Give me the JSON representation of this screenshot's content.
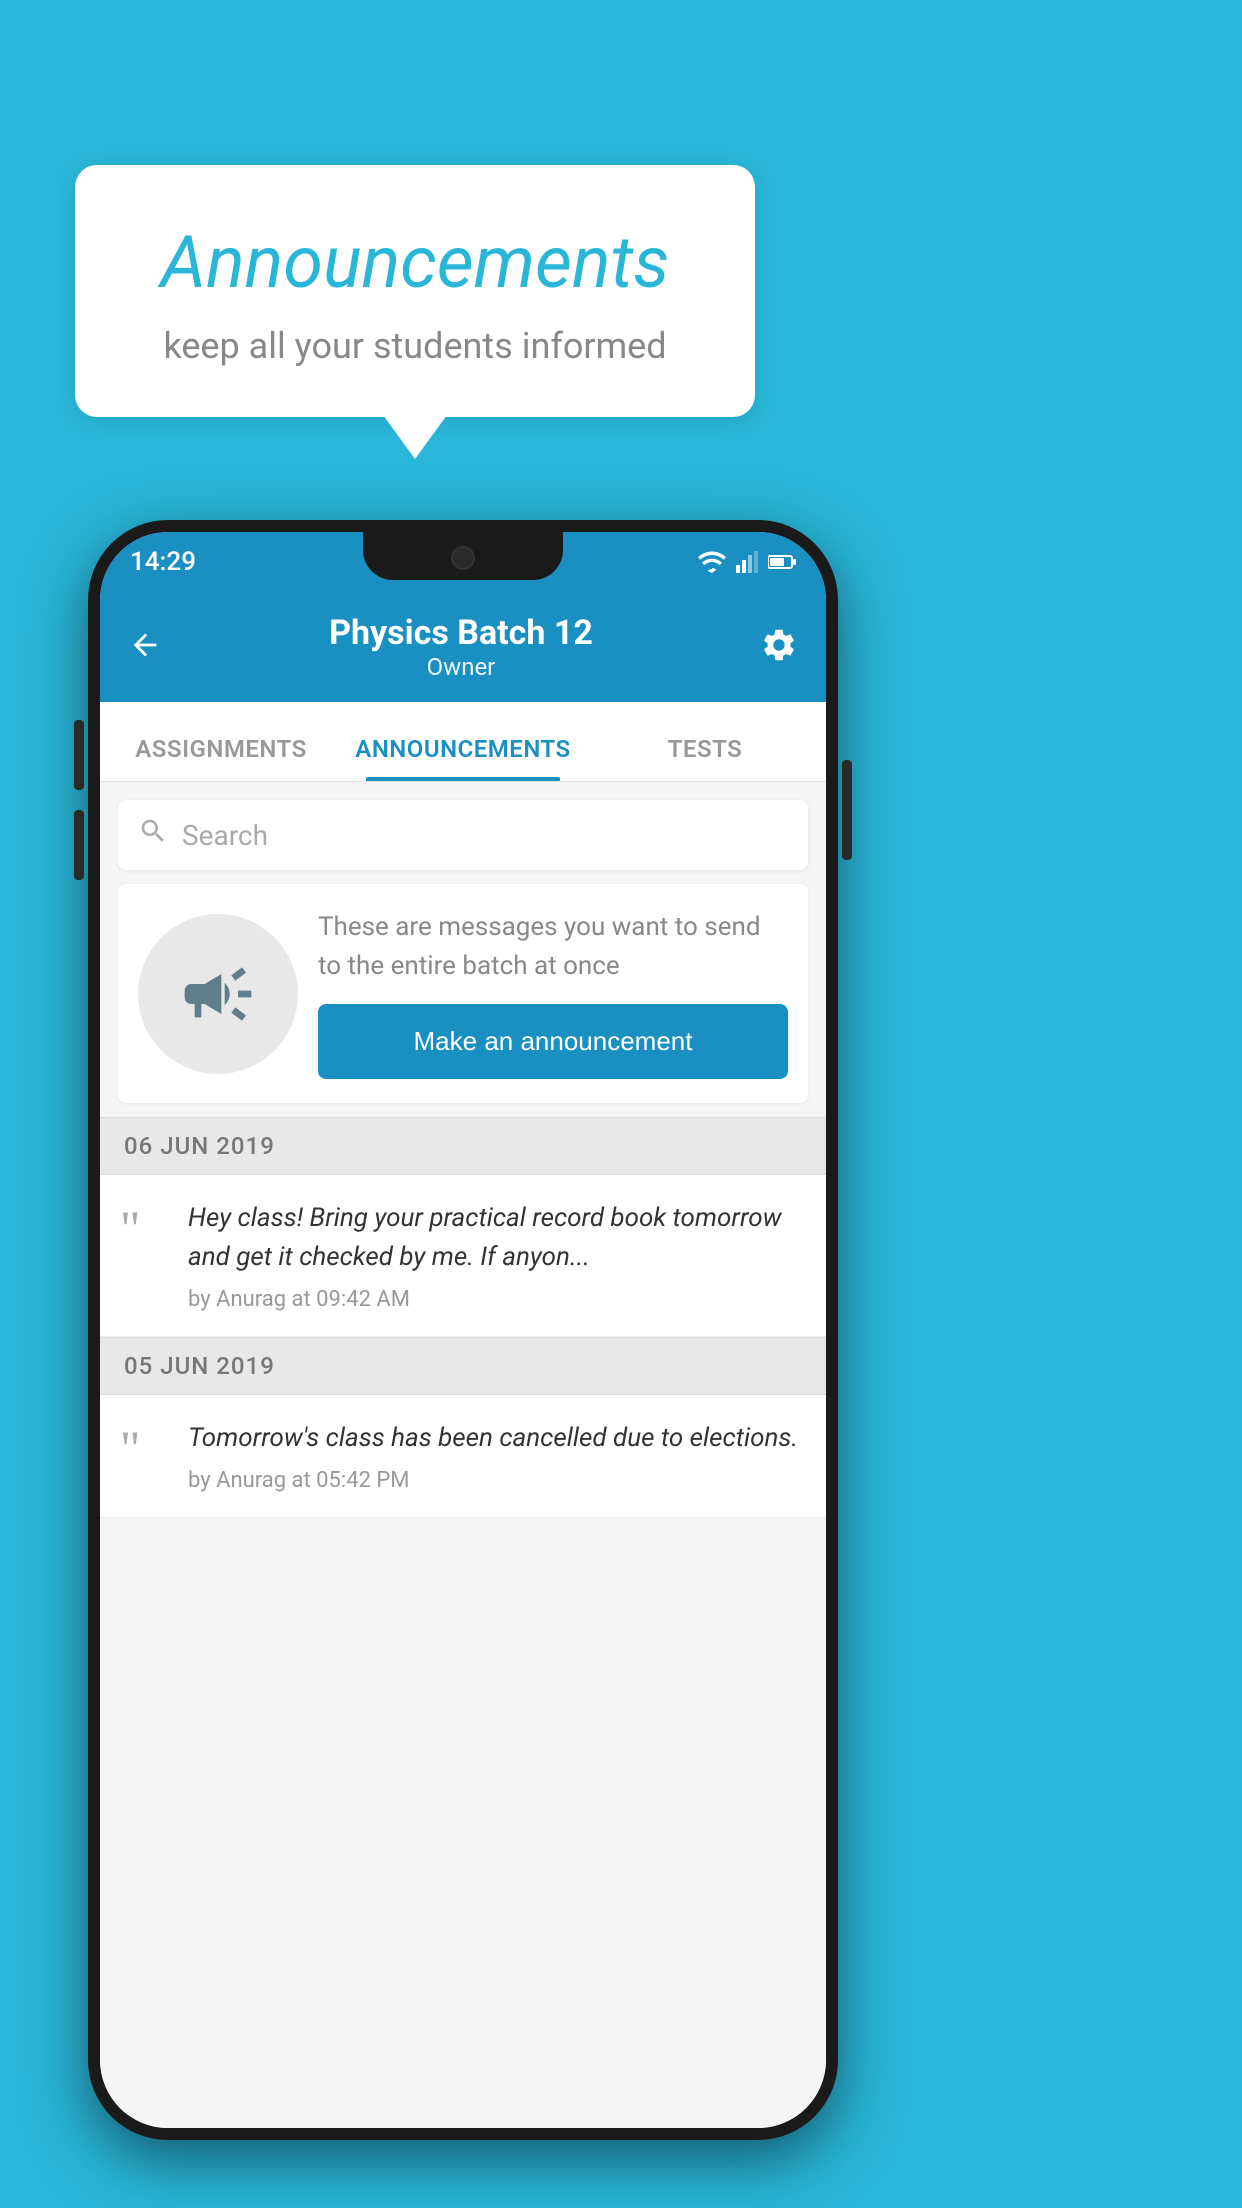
{
  "background_color": "#29b6d8",
  "speech_bubble": {
    "title": "Announcements",
    "subtitle": "keep all your students informed"
  },
  "phone": {
    "status_bar": {
      "time": "14:29"
    },
    "header": {
      "title": "Physics Batch 12",
      "subtitle": "Owner",
      "back_label": "←",
      "settings_label": "⚙"
    },
    "tabs": [
      {
        "label": "ASSIGNMENTS",
        "active": false
      },
      {
        "label": "ANNOUNCEMENTS",
        "active": true
      },
      {
        "label": "TESTS",
        "active": false
      }
    ],
    "search": {
      "placeholder": "Search"
    },
    "prompt": {
      "text": "These are messages you want to send to the entire batch at once",
      "button_label": "Make an announcement"
    },
    "announcements": [
      {
        "date": "06  JUN  2019",
        "text": "Hey class! Bring your practical record book tomorrow and get it checked by me. If anyon...",
        "meta": "by Anurag at 09:42 AM"
      },
      {
        "date": "05  JUN  2019",
        "text": "Tomorrow's class has been cancelled due to elections.",
        "meta": "by Anurag at 05:42 PM"
      }
    ]
  }
}
